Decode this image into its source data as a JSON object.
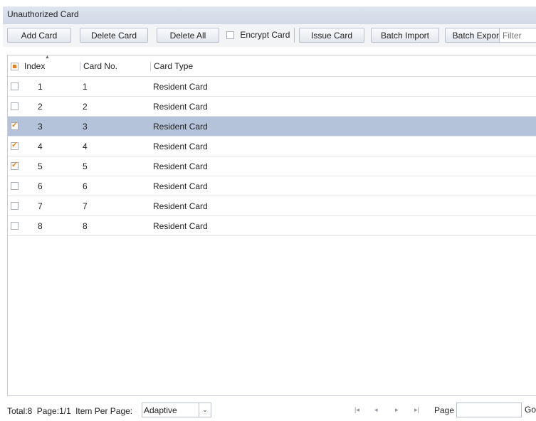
{
  "panel": {
    "title": "Unauthorized Card"
  },
  "toolbar": {
    "add_card": "Add Card",
    "delete_card": "Delete Card",
    "delete_all": "Delete All",
    "encrypt_card": "Encrypt Card",
    "encrypt_checked": false,
    "issue_card": "Issue Card",
    "batch_import": "Batch Import",
    "batch_export": "Batch Export",
    "filter_placeholder": "Filter"
  },
  "table": {
    "columns": {
      "index": "Index",
      "card_no": "Card No.",
      "card_type": "Card Type"
    },
    "header_checkbox_state": "partial",
    "rows": [
      {
        "index": "1",
        "card_no": "1",
        "card_type": "Resident Card",
        "checked": false,
        "selected": false
      },
      {
        "index": "2",
        "card_no": "2",
        "card_type": "Resident Card",
        "checked": false,
        "selected": false
      },
      {
        "index": "3",
        "card_no": "3",
        "card_type": "Resident Card",
        "checked": true,
        "selected": true
      },
      {
        "index": "4",
        "card_no": "4",
        "card_type": "Resident Card",
        "checked": true,
        "selected": false
      },
      {
        "index": "5",
        "card_no": "5",
        "card_type": "Resident Card",
        "checked": true,
        "selected": false
      },
      {
        "index": "6",
        "card_no": "6",
        "card_type": "Resident Card",
        "checked": false,
        "selected": false
      },
      {
        "index": "7",
        "card_no": "7",
        "card_type": "Resident Card",
        "checked": false,
        "selected": false
      },
      {
        "index": "8",
        "card_no": "8",
        "card_type": "Resident Card",
        "checked": false,
        "selected": false
      }
    ]
  },
  "footer": {
    "total": "Total:8",
    "page_info": "Page:1/1",
    "item_per_page_label": "Item Per Page:",
    "item_per_page_value": "Adaptive",
    "page_label": "Page",
    "page_input_value": "",
    "go_label": "Go"
  },
  "colors": {
    "selected_row": "#b4c3da",
    "check_accent": "#e8821c",
    "title_bar": "#d6dde9"
  },
  "icons": {
    "dropdown": "chevron-down-icon",
    "first": "first-page-icon",
    "prev": "prev-page-icon",
    "next": "next-page-icon",
    "last": "last-page-icon",
    "sort": "sort-up-icon"
  }
}
